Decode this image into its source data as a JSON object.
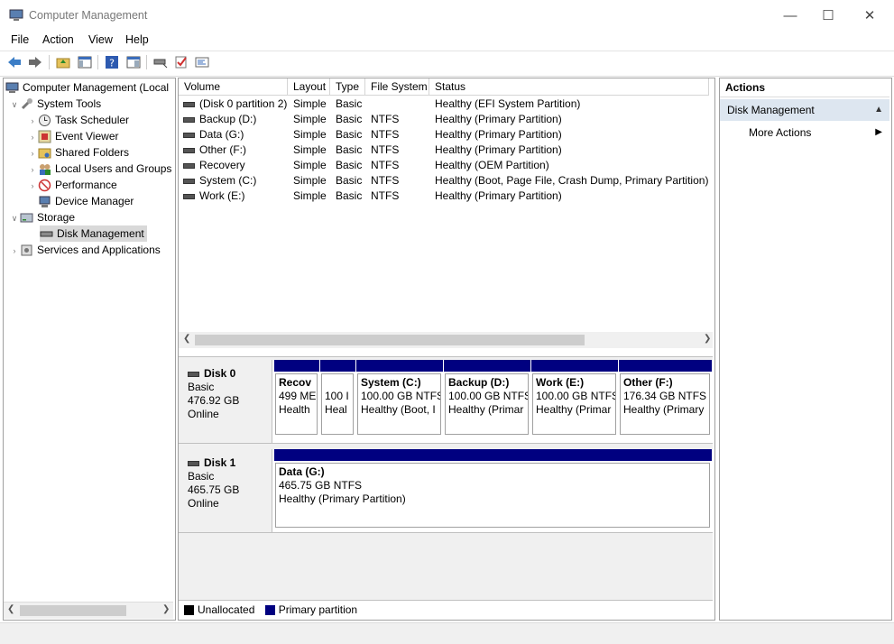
{
  "window": {
    "title": "Computer Management",
    "controls": {
      "minimize": "—",
      "maximize": "☐",
      "close": "✕"
    }
  },
  "menu": [
    "File",
    "Action",
    "View",
    "Help"
  ],
  "toolbar": {
    "icons": [
      "back-icon",
      "forward-icon",
      "up-folder-icon",
      "show-hide-tree-icon",
      "help-icon",
      "properties-icon",
      "disk-icon",
      "check-icon",
      "console-icon"
    ]
  },
  "tree": {
    "root": "Computer Management (Local",
    "system_tools": "System Tools",
    "task_scheduler": "Task Scheduler",
    "event_viewer": "Event Viewer",
    "shared_folders": "Shared Folders",
    "local_users": "Local Users and Groups",
    "performance": "Performance",
    "device_manager": "Device Manager",
    "storage": "Storage",
    "disk_management": "Disk Management",
    "services": "Services and Applications"
  },
  "volumes": {
    "headers": [
      "Volume",
      "Layout",
      "Type",
      "File System",
      "Status"
    ],
    "rows": [
      [
        "(Disk 0 partition 2)",
        "Simple",
        "Basic",
        "",
        "Healthy (EFI System Partition)"
      ],
      [
        "Backup (D:)",
        "Simple",
        "Basic",
        "NTFS",
        "Healthy (Primary Partition)"
      ],
      [
        "Data (G:)",
        "Simple",
        "Basic",
        "NTFS",
        "Healthy (Primary Partition)"
      ],
      [
        "Other (F:)",
        "Simple",
        "Basic",
        "NTFS",
        "Healthy (Primary Partition)"
      ],
      [
        "Recovery",
        "Simple",
        "Basic",
        "NTFS",
        "Healthy (OEM Partition)"
      ],
      [
        "System (C:)",
        "Simple",
        "Basic",
        "NTFS",
        "Healthy (Boot, Page File, Crash Dump, Primary Partition)"
      ],
      [
        "Work (E:)",
        "Simple",
        "Basic",
        "NTFS",
        "Healthy (Primary Partition)"
      ]
    ]
  },
  "disk0": {
    "name": "Disk 0",
    "type": "Basic",
    "size": "476.92 GB",
    "state": "Online",
    "partitions": [
      {
        "name": "Recov",
        "size": "499 ME",
        "status": "Health"
      },
      {
        "name": "",
        "size": "100 I",
        "status": "Heal"
      },
      {
        "name": "System  (C:)",
        "size": "100.00 GB NTFS",
        "status": "Healthy (Boot, I"
      },
      {
        "name": "Backup  (D:)",
        "size": "100.00 GB NTFS",
        "status": "Healthy (Primar"
      },
      {
        "name": "Work  (E:)",
        "size": "100.00 GB NTFS",
        "status": "Healthy (Primar"
      },
      {
        "name": "Other  (F:)",
        "size": "176.34 GB NTFS",
        "status": "Healthy (Primary"
      }
    ]
  },
  "disk1": {
    "name": "Disk 1",
    "type": "Basic",
    "size": "465.75 GB",
    "state": "Online",
    "partition": {
      "name": "Data  (G:)",
      "size": "465.75 GB NTFS",
      "status": "Healthy (Primary Partition)"
    }
  },
  "legend": {
    "unallocated": "Unallocated",
    "primary": "Primary partition",
    "unallocated_color": "#000000",
    "primary_color": "#000080"
  },
  "actions": {
    "header": "Actions",
    "section": "Disk Management",
    "more": "More Actions"
  },
  "colors": {
    "accent": "#000080",
    "selection": "#cce8ff",
    "section_bg": "#dde6f0"
  }
}
